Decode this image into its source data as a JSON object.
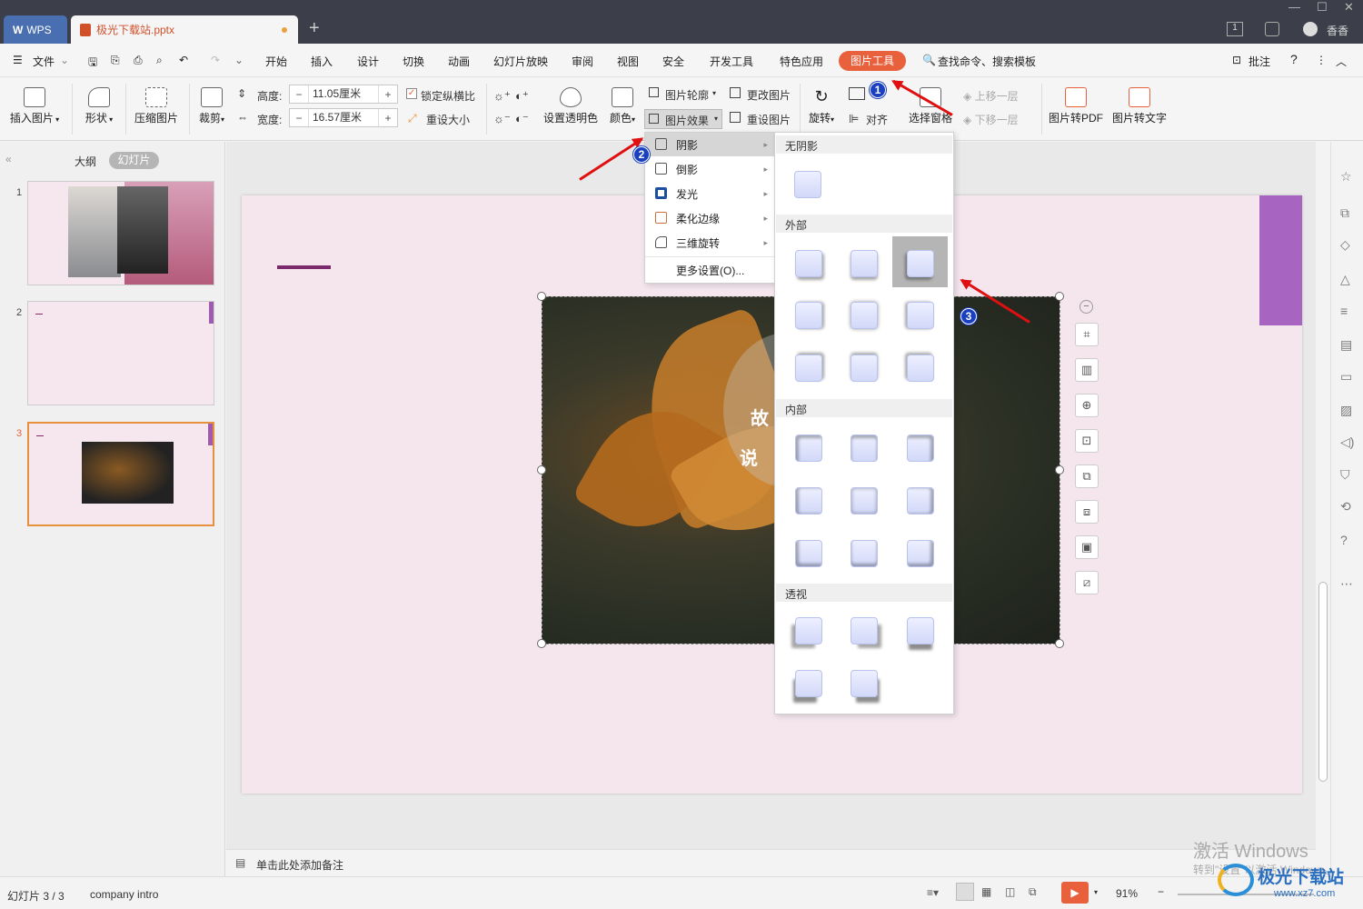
{
  "tabs": {
    "wps": "WPS",
    "doc": "极光下载站.pptx",
    "new": "+"
  },
  "titlebar": {
    "user": "香香",
    "page_box": "1"
  },
  "menubar": {
    "file": "文件",
    "items": [
      "开始",
      "插入",
      "设计",
      "切换",
      "动画",
      "幻灯片放映",
      "审阅",
      "视图",
      "安全",
      "开发工具",
      "特色应用",
      "图片工具"
    ],
    "search": "查找命令、搜索模板",
    "comment": "批注",
    "help": "?"
  },
  "ribbon": {
    "insert_pic": "插入图片",
    "shape": "形状",
    "compress": "压缩图片",
    "crop": "裁剪",
    "height_label": "高度:",
    "height_value": "11.05厘米",
    "width_label": "宽度:",
    "width_value": "16.57厘米",
    "lock_ratio": "锁定纵横比",
    "reset_size": "重设大小",
    "set_transparent": "设置透明色",
    "color": "颜色",
    "outline": "图片轮廓",
    "effect": "图片效果",
    "change_pic": "更改图片",
    "reset_pic": "重设图片",
    "rotate": "旋转",
    "align": "对齐",
    "select_pane": "选择窗格",
    "up": "上移一层",
    "down": "下移一层",
    "to_pdf": "图片转PDF",
    "to_text": "图片转文字"
  },
  "panel": {
    "outline_tab": "大纲",
    "slides_tab": "幻灯片",
    "nums": [
      "1",
      "2",
      "3"
    ]
  },
  "effect_menu": {
    "items": [
      "阴影",
      "倒影",
      "发光",
      "柔化边缘",
      "三维旋转"
    ],
    "more": "更多设置(O)..."
  },
  "shadow_sub": {
    "none": "无阴影",
    "outer": "外部",
    "inner": "内部",
    "perspective": "透视"
  },
  "photo_text": {
    "line1": "故",
    "line2": "说"
  },
  "notes": {
    "placeholder": "单击此处添加备注"
  },
  "status": {
    "slide": "幻灯片 3 / 3",
    "theme": "company intro",
    "zoom": "91%"
  },
  "watermark": {
    "activate": "激活 Windows",
    "goto": "转到\"设置\"以激活 Windows。",
    "site": "极光下载站",
    "url": "www.xz7.com"
  },
  "badges": [
    "1",
    "2",
    "3"
  ]
}
